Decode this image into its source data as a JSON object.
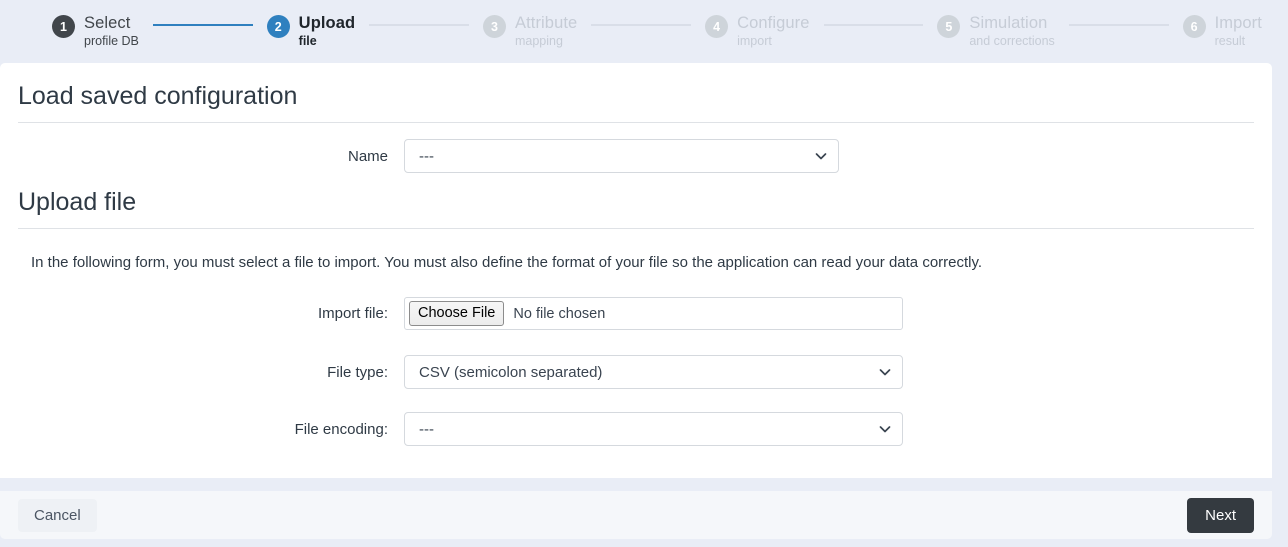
{
  "stepper": {
    "steps": [
      {
        "number": "1",
        "title": "Select",
        "subtitle": "profile DB",
        "state": "done"
      },
      {
        "number": "2",
        "title": "Upload",
        "subtitle": "file",
        "state": "current"
      },
      {
        "number": "3",
        "title": "Attribute",
        "subtitle": "mapping",
        "state": "todo"
      },
      {
        "number": "4",
        "title": "Configure",
        "subtitle": "import",
        "state": "todo"
      },
      {
        "number": "5",
        "title": "Simulation",
        "subtitle": "and corrections",
        "state": "todo"
      },
      {
        "number": "6",
        "title": "Import",
        "subtitle": "result",
        "state": "todo"
      }
    ],
    "colors": {
      "done": "#41464b",
      "current": "#2f80bf",
      "todo": "#ced4da",
      "connector_active": "#2f80bf",
      "connector_inactive": "#d9dee8"
    }
  },
  "load_saved_configuration": {
    "heading": "Load saved configuration",
    "name_label": "Name",
    "name_value": "---"
  },
  "upload_file": {
    "heading": "Upload file",
    "intro": "In the following form, you must select a file to import. You must also define the format of your file so the application can read your data correctly.",
    "import_file_label": "Import file:",
    "choose_file_button": "Choose File",
    "no_file_chosen": "No file chosen",
    "file_type_label": "File type:",
    "file_type_value": "CSV (semicolon separated)",
    "file_encoding_label": "File encoding:",
    "file_encoding_value": "---"
  },
  "footer": {
    "cancel_label": "Cancel",
    "next_label": "Next",
    "next_color": "#343a40"
  },
  "icons": {
    "chevron_down": "chevron-down-icon"
  }
}
